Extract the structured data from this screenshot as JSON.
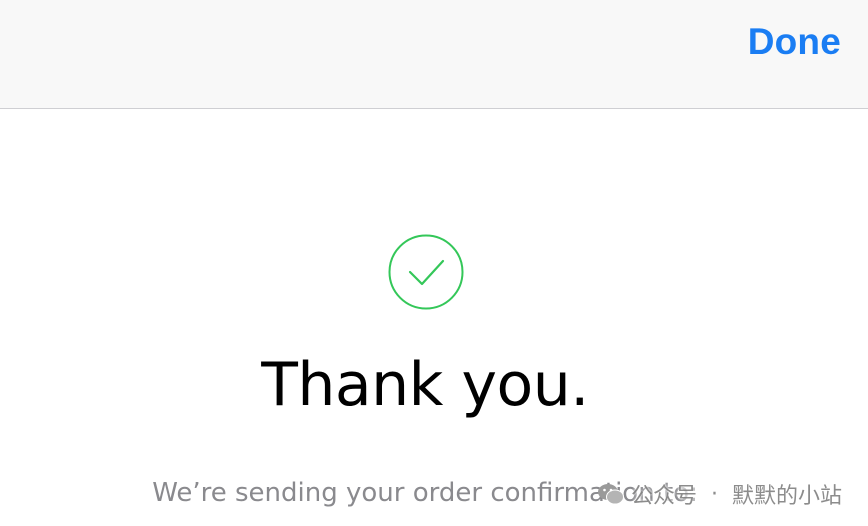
{
  "nav": {
    "done_label": "Done"
  },
  "content": {
    "title": "Thank you.",
    "subtitle": "We’re sending your order confirmation to:"
  },
  "watermark": {
    "prefix": "公众号",
    "separator": "·",
    "name": "默默的小站"
  },
  "colors": {
    "accent": "#1a7df3",
    "success": "#34c759",
    "secondary_text": "#8a8a8e",
    "nav_background": "#f8f8f8"
  },
  "icons": {
    "success": "checkmark-circle-icon",
    "watermark": "wechat-icon"
  }
}
